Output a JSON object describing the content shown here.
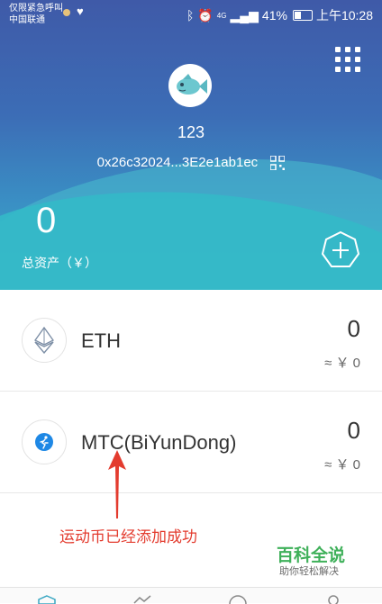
{
  "status_bar": {
    "carrier_line1": "仅限紧急呼叫",
    "carrier_line2": "中国联通",
    "battery": "41%",
    "time": "上午10:28",
    "network": "4G"
  },
  "wallet": {
    "name": "123",
    "address": "0x26c32024...3E2e1ab1ec",
    "total_value": "0",
    "total_label": "总资产（￥）"
  },
  "tokens": [
    {
      "name": "ETH",
      "amount": "0",
      "fiat": "≈ ￥ 0",
      "icon": "ethereum-icon"
    },
    {
      "name": "MTC(BiYunDong)",
      "amount": "0",
      "fiat": "≈ ￥ 0",
      "icon": "running-icon"
    }
  ],
  "annotation": "运动币已经添加成功",
  "watermark": {
    "title": "百科全说",
    "subtitle": "助你轻松解决"
  },
  "colors": {
    "header_top": "#3f5aa8",
    "header_bottom": "#33b3c8",
    "annotation": "#e33b2e",
    "mtc_icon": "#1e88e5"
  }
}
